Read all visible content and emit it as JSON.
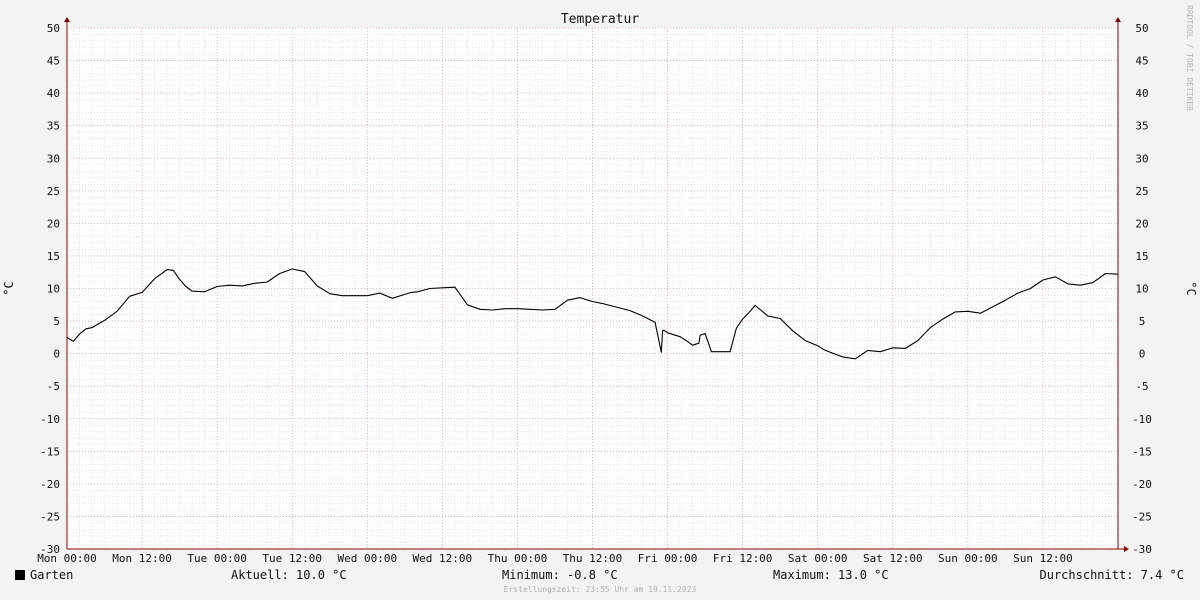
{
  "chart_data": {
    "type": "line",
    "title": "Temperatur",
    "ylabel": "°C",
    "ylim": [
      -30,
      50
    ],
    "y_ticks": [
      "50",
      "45",
      "40",
      "35",
      "30",
      "25",
      "20",
      "15",
      "10",
      "5",
      "0",
      "-5",
      "-10",
      "-15",
      "-20",
      "-25",
      "-30"
    ],
    "x_tick_labels": [
      "Mon 00:00",
      "Mon 12:00",
      "Tue 00:00",
      "Tue 12:00",
      "Wed 00:00",
      "Wed 12:00",
      "Thu 00:00",
      "Thu 12:00",
      "Fri 00:00",
      "Fri 12:00",
      "Sat 00:00",
      "Sat 12:00",
      "Sun 00:00",
      "Sun 12:00"
    ],
    "xlim_hours": [
      0,
      168
    ],
    "grid": true,
    "legend_position": "bottom",
    "series": [
      {
        "name": "Garten",
        "color": "#000000",
        "x_hours": [
          0,
          1,
          2,
          3,
          4,
          6,
          8,
          10,
          12,
          14,
          16,
          17,
          18,
          19,
          20,
          22,
          24,
          26,
          28,
          30,
          32,
          34,
          36,
          38,
          40,
          42,
          44,
          46,
          48,
          50,
          52,
          54,
          55,
          56,
          58,
          60,
          62,
          64,
          66,
          68,
          70,
          72,
          74,
          76,
          78,
          80,
          82,
          84,
          86,
          88,
          90,
          92,
          94,
          95,
          95.2,
          95.4,
          96,
          98,
          99,
          100,
          101,
          101.2,
          102,
          103,
          103.5,
          104,
          106,
          107,
          108,
          109,
          110,
          112,
          114,
          116,
          118,
          120,
          121,
          122,
          124,
          126,
          128,
          130,
          132,
          134,
          136,
          138,
          140,
          142,
          144,
          146,
          148,
          150,
          152,
          154,
          156,
          158,
          160,
          162,
          164,
          166,
          168
        ],
        "values": [
          2.5,
          1.9,
          3.0,
          3.8,
          4.0,
          5.1,
          6.5,
          8.8,
          9.4,
          11.5,
          12.9,
          12.8,
          11.4,
          10.3,
          9.6,
          9.5,
          10.3,
          10.5,
          10.4,
          10.8,
          11.0,
          12.3,
          13.0,
          12.6,
          10.4,
          9.2,
          8.9,
          8.9,
          8.9,
          9.3,
          8.5,
          9.1,
          9.4,
          9.5,
          10.0,
          10.1,
          10.2,
          7.5,
          6.8,
          6.7,
          6.9,
          6.9,
          6.8,
          6.7,
          6.8,
          8.2,
          8.6,
          8.0,
          7.6,
          7.1,
          6.6,
          5.8,
          4.8,
          0.2,
          3.5,
          3.6,
          3.2,
          2.6,
          2.0,
          1.3,
          1.6,
          2.8,
          3.1,
          0.3,
          0.3,
          0.3,
          0.3,
          3.9,
          5.3,
          6.3,
          7.4,
          5.8,
          5.4,
          3.5,
          2.0,
          1.2,
          0.6,
          0.2,
          -0.5,
          -0.8,
          0.5,
          0.3,
          0.9,
          0.8,
          2.0,
          4.0,
          5.3,
          6.4,
          6.5,
          6.2,
          7.2,
          8.2,
          9.3,
          10.0,
          11.3,
          11.8,
          10.7,
          10.5,
          10.9,
          12.3,
          12.2,
          11.0,
          10.1,
          9.9,
          9.9,
          10.0,
          10.0
        ]
      }
    ]
  },
  "legend": {
    "series_name": "Garten",
    "current": "Aktuell: 10.0 °C",
    "minimum": "Minimum: -0.8 °C",
    "maximum": "Maximum: 13.0 °C",
    "average": "Durchschnitt: 7.4 °C"
  },
  "footer": "Erstellungszeit: 23:55 Uhr am 19.11.2023",
  "credit": "RRDTOOL / TOBI OETIKER",
  "colors": {
    "background": "#f3f3f3",
    "plot_background": "#ffffff",
    "minor_grid": "#d8d8d8",
    "major_grid": "#e8a0a0",
    "axis": "#8b0000",
    "line": "#000000"
  }
}
